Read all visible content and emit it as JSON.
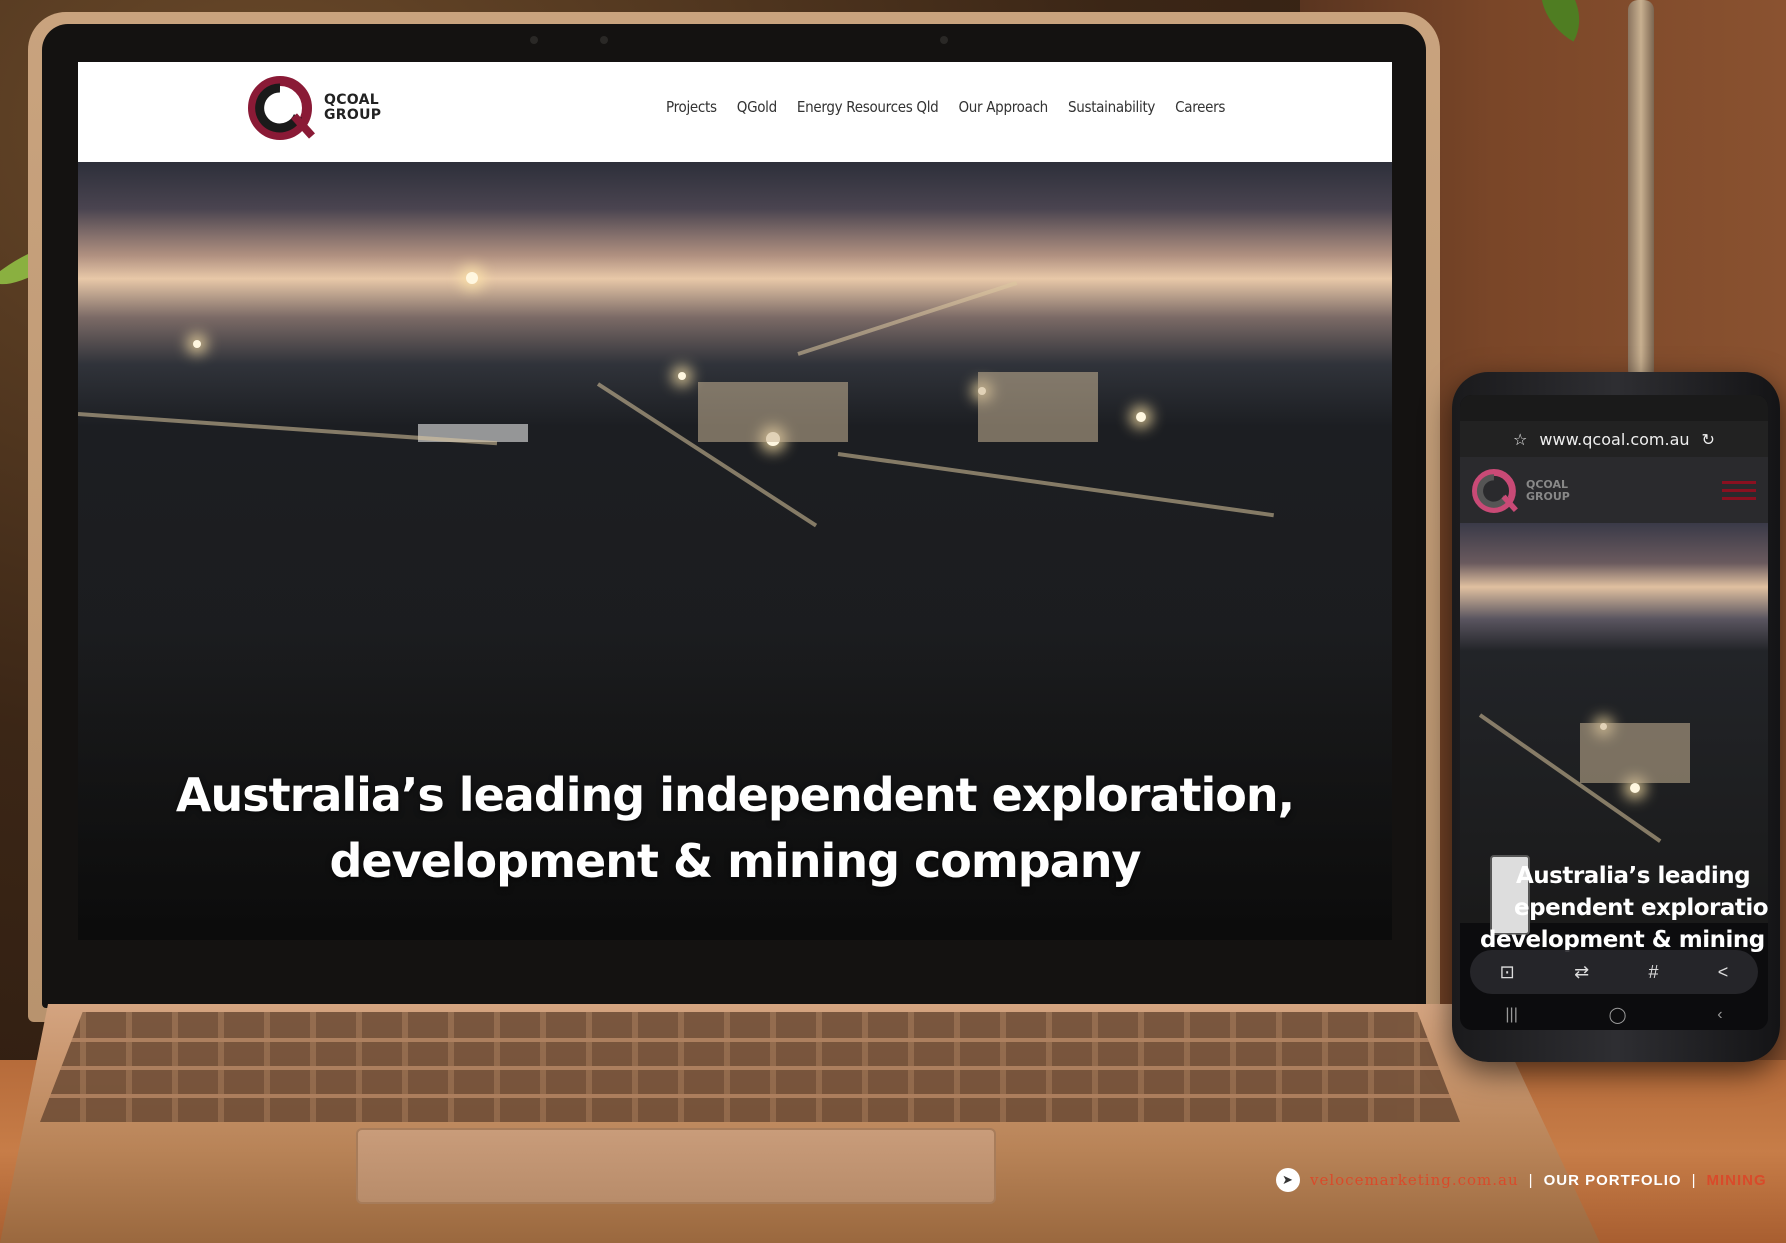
{
  "laptop_site": {
    "logo": {
      "line1": "QCOAL",
      "line2": "GROUP",
      "brand_color": "#8a1a36"
    },
    "nav": [
      "Projects",
      "QGold",
      "Energy Resources Qld",
      "Our Approach",
      "Sustainability",
      "Careers"
    ],
    "hero": {
      "line1": "Australia’s leading independent exploration,",
      "line2": "development & mining company"
    }
  },
  "phone_site": {
    "url": "www.qcoal.com.au",
    "logo": {
      "line1": "QCOAL",
      "line2": "GROUP"
    },
    "hero": {
      "line1": "Australia’s leading",
      "line2": "ependent exploration,",
      "line3": "development & mining"
    },
    "toolbar_icons": [
      "scan-icon",
      "translate-icon",
      "hash-icon",
      "share-icon"
    ],
    "toolbar_glyphs": [
      "⊡",
      "⇄",
      "#",
      "<"
    ],
    "navbar_glyphs": [
      "|||",
      "◯",
      "‹"
    ]
  },
  "credit": {
    "site": "velocemarketing.com.au",
    "sep1": "|",
    "portfolio": "OUR PORTFOLIO",
    "sep2": "|",
    "category": "MINING",
    "accent_color": "#d94a2a"
  }
}
